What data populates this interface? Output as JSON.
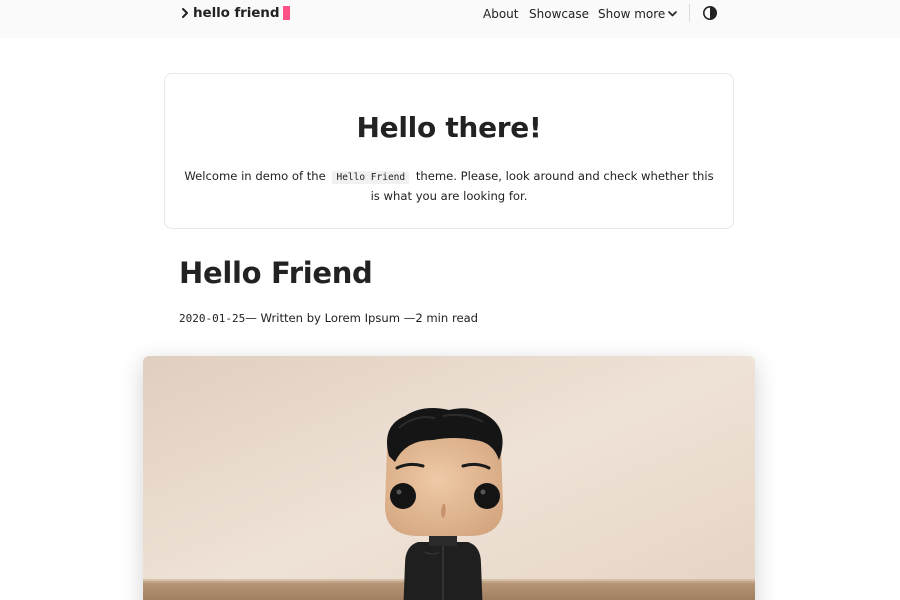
{
  "header": {
    "logo_text": "hello friend",
    "logo_chevron_icon": "chevron-right-icon",
    "accent_color": "#fe5186",
    "nav": [
      {
        "label": "About"
      },
      {
        "label": "Showcase"
      },
      {
        "label": "Show more"
      }
    ],
    "dropdown_icon": "chevron-down-icon",
    "theme_toggle_icon": "half-circle-icon"
  },
  "hero": {
    "title": "Hello there!",
    "text_before": "Welcome in demo of the",
    "code": "Hello Friend",
    "text_after": "theme. Please, look around and check whether this is what you are looking for."
  },
  "post": {
    "title": "Hello Friend",
    "date": "2020-01-25",
    "meta_written": "— Written by Lorem Ipsum —",
    "read_time": "2 min read",
    "cover_image": "figurine-photo"
  }
}
